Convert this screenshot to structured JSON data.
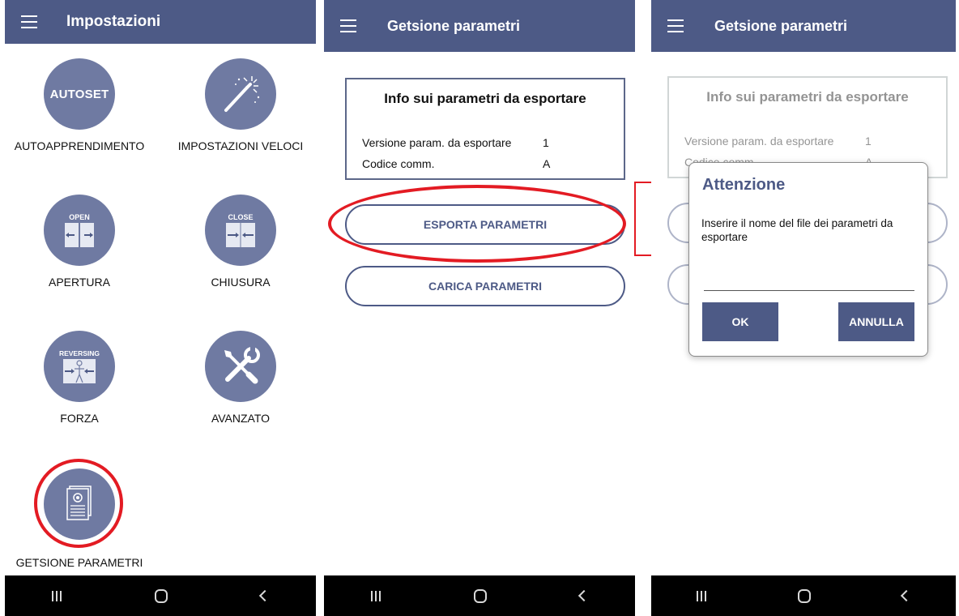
{
  "screen1": {
    "title": "Impostazioni",
    "tiles": [
      {
        "label": "AUTOAPPRENDIMENTO",
        "icon": "autoset-icon",
        "badge": "AUTOSET"
      },
      {
        "label": "IMPOSTAZIONI VELOCI",
        "icon": "magic-wand-icon"
      },
      {
        "label": "APERTURA",
        "icon": "door-open-icon",
        "badge": "OPEN"
      },
      {
        "label": "CHIUSURA",
        "icon": "door-close-icon",
        "badge": "CLOSE"
      },
      {
        "label": "FORZA",
        "icon": "reversing-icon",
        "badge": "REVERSING"
      },
      {
        "label": "AVANZATO",
        "icon": "tools-icon"
      },
      {
        "label": "GETSIONE PARAMETRI",
        "icon": "parameters-document-icon"
      }
    ]
  },
  "screen2": {
    "title": "Getsione parametri",
    "info": {
      "heading": "Info sui parametri da esportare",
      "rows": [
        {
          "label": "Versione param. da esportare",
          "value": "1"
        },
        {
          "label": "Codice comm.",
          "value": "A"
        }
      ]
    },
    "export_button": "ESPORTA PARAMETRI",
    "load_button": "CARICA PARAMETRI"
  },
  "screen3": {
    "title": "Getsione parametri",
    "info": {
      "heading": "Info sui parametri da esportare",
      "rows": [
        {
          "label": "Versione param. da esportare",
          "value": "1"
        },
        {
          "label": "Codice comm.",
          "value": "A"
        }
      ]
    },
    "dialog": {
      "title": "Attenzione",
      "message": "Inserire il nome del file dei parametri da esportare",
      "input_value": "",
      "ok": "OK",
      "cancel": "ANNULLA"
    }
  },
  "colors": {
    "primary": "#4d5a86",
    "icon_fill": "#6f7aa2",
    "highlight": "#e31b23"
  }
}
